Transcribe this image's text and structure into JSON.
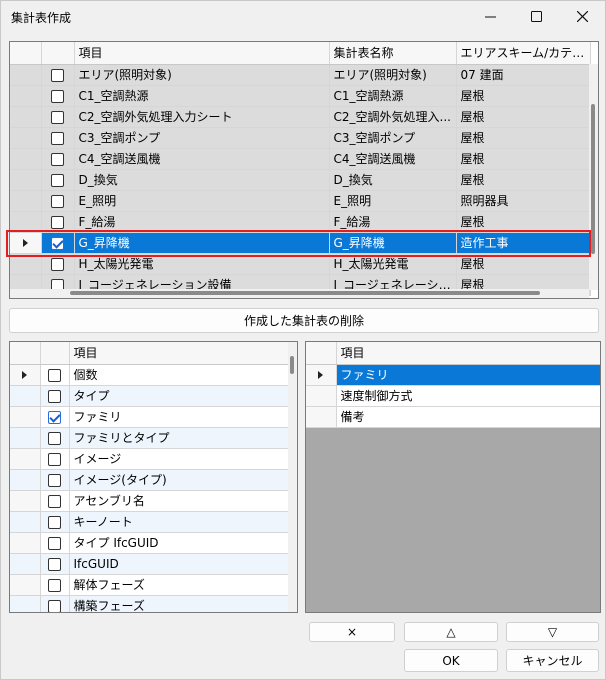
{
  "window": {
    "title": "集計表作成",
    "min_glyph": "—",
    "max_glyph": "☐",
    "close_glyph": "✕"
  },
  "schedule_grid": {
    "headers": {
      "item": "項目",
      "schedule_name": "集計表名称",
      "area_scheme": "エリアスキーム/カテゴリ"
    },
    "rows": [
      {
        "checked": false,
        "item": "エリア(照明対象)",
        "name": "エリア(照明対象)",
        "category": "07 建面"
      },
      {
        "checked": false,
        "item": "C1_空調熱源",
        "name": "C1_空調熱源",
        "category": "屋根"
      },
      {
        "checked": false,
        "item": "C2_空調外気処理入力シート",
        "name": "C2_空調外気処理入...",
        "category": "屋根"
      },
      {
        "checked": false,
        "item": "C3_空調ポンプ",
        "name": "C3_空調ポンプ",
        "category": "屋根"
      },
      {
        "checked": false,
        "item": "C4_空調送風機",
        "name": "C4_空調送風機",
        "category": "屋根"
      },
      {
        "checked": false,
        "item": "D_換気",
        "name": "D_換気",
        "category": "屋根"
      },
      {
        "checked": false,
        "item": "E_照明",
        "name": "E_照明",
        "category": "照明器具"
      },
      {
        "checked": false,
        "item": "F_給湯",
        "name": "F_給湯",
        "category": "屋根"
      },
      {
        "checked": true,
        "item": "G_昇降機",
        "name": "G_昇降機",
        "category": "造作工事",
        "selected": true
      },
      {
        "checked": false,
        "item": "H_太陽光発電",
        "name": "H_太陽光発電",
        "category": "屋根"
      },
      {
        "checked": false,
        "item": "I_コージェネレーション設備",
        "name": "I_コージェネレーション設備",
        "category": "屋根"
      }
    ]
  },
  "delete_button_label": "作成した集計表の削除",
  "fields_grid": {
    "header": "項目",
    "rows": [
      {
        "checked": false,
        "label": "個数",
        "current": true
      },
      {
        "checked": false,
        "label": "タイプ"
      },
      {
        "checked": true,
        "label": "ファミリ"
      },
      {
        "checked": false,
        "label": "ファミリとタイプ"
      },
      {
        "checked": false,
        "label": "イメージ"
      },
      {
        "checked": false,
        "label": "イメージ(タイプ)"
      },
      {
        "checked": false,
        "label": "アセンブリ名"
      },
      {
        "checked": false,
        "label": "キーノート"
      },
      {
        "checked": false,
        "label": "タイプ IfcGUID"
      },
      {
        "checked": false,
        "label": "IfcGUID"
      },
      {
        "checked": false,
        "label": "解体フェーズ"
      },
      {
        "checked": false,
        "label": "構築フェーズ"
      }
    ]
  },
  "selected_fields_grid": {
    "header": "項目",
    "rows": [
      {
        "label": "ファミリ",
        "selected": true
      },
      {
        "label": "速度制御方式"
      },
      {
        "label": "備考"
      }
    ]
  },
  "buttons": {
    "remove": "×",
    "up": "△",
    "down": "▽",
    "ok": "OK",
    "cancel": "キャンセル"
  },
  "colors": {
    "selection": "#0a78d7",
    "highlight_outline": "#e02020"
  }
}
